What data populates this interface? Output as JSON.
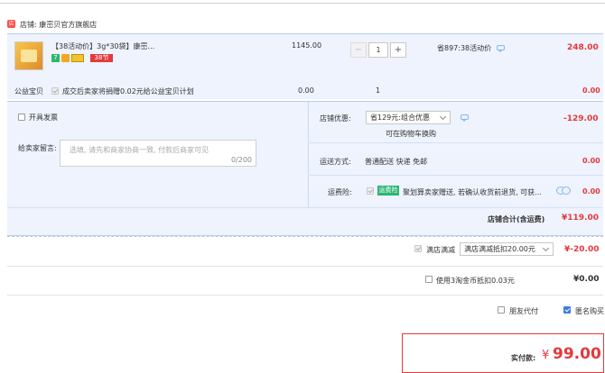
{
  "store": {
    "name": "店铺: 康崈贝官方旗舰店",
    "badge": "店"
  },
  "item": {
    "title": "【38活动价】3g*30袋】康崈...",
    "tags": {
      "t1": "7",
      "t2": "",
      "t3": "",
      "t4": "38节"
    },
    "price": "1145.00",
    "quantity": "1",
    "minus": "−",
    "plus": "+",
    "promo": "省897:38活动价",
    "subtotal": "248.00"
  },
  "charity": {
    "label": "公益宝贝",
    "text": "成交后卖家将捐赠0.02元给公益宝贝计划",
    "price": "0.00",
    "qty": "1",
    "total": "0.00"
  },
  "invoice": {
    "label": "开具发票"
  },
  "message": {
    "label": "给卖家留言:",
    "placeholder": "选填, 请先和商家协商一致, 付款后商家可见",
    "counter": "0/200"
  },
  "discount": {
    "label": "店铺优惠:",
    "selected": "省129元:组合优惠",
    "note": "可在购物车换购",
    "value": "-129.00"
  },
  "shipping": {
    "label": "运送方式:",
    "value": "普通配送 快递 免邮",
    "price": "0.00"
  },
  "insurance": {
    "label": "运费险:",
    "badge": "运费险",
    "text": "聚划算卖家赠送, 若确认收货前退货, 可获...",
    "price": "0.00"
  },
  "store_total": {
    "label": "店铺合计(含运费)",
    "value": "¥119.00"
  },
  "tmall_promo": {
    "label": "满店满减",
    "selected": "满店满减抵扣20.00元",
    "value": "¥-20.00"
  },
  "coins": {
    "label": "使用3淘金币抵扣0.03元",
    "value": "¥0.00"
  },
  "friend_pay": {
    "label": "朋友代付"
  },
  "anonymous": {
    "label": "匿名购买"
  },
  "pay": {
    "label": "实付款:",
    "currency": "¥",
    "amount": "99.00"
  },
  "colors": {
    "accent_red": "#e4393c",
    "panel_blue": "#eef3fd",
    "border_blue": "#b7cdf2"
  }
}
